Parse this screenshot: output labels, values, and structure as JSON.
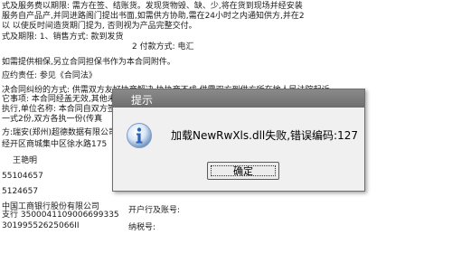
{
  "document": {
    "lines": [
      "式及服务费以期限: 需方在签、结账货。发现货物毁、缺、少,将在货到现场并经安装",
      "服务自产品产,并同进路阁门提出书面,如需供方协助,需在24小时之内通知供方,并在2",
      "以 以使反时间造货期门提为, 否则视为产品完整交付。",
      "式及期限: 1、销售方式: 款到发货",
      "2  付款方式: 电汇",
      "如需提供相保,另立合同担保书作为本合同附件。",
      "应约责任:    参见《合同法》",
      "决合同纠纷的方式: 供需双方友好协商解决,协协商不成,供需双方到供方所在地人民法院起诉。",
      "它事项: 本合同经盖无效,其他未",
      "执行,单位名称:  本合同自双方签字(盖",
      "一式2份,双方各执一份(传真",
      "方:瑞安(郑州)超德数据有限公司",
      "经开区商城集中区徐水路175",
      "王艳明",
      "55104657",
      "5124657",
      "中国工商银行股份有限公司",
      "支行 3500041109006699335",
      "30199552625066II"
    ],
    "right_fragments": [
      "开户行及账号:",
      "纳税号:"
    ]
  },
  "dialog": {
    "title": "提示",
    "message": "加载NewRwXls.dll失败,错误编码:127",
    "ok_label": "确定"
  },
  "icons": {
    "dialog_icon": "info-icon"
  },
  "colors": {
    "titlebar": "#7a7a7a",
    "icon_blue": "#2a64b4"
  }
}
